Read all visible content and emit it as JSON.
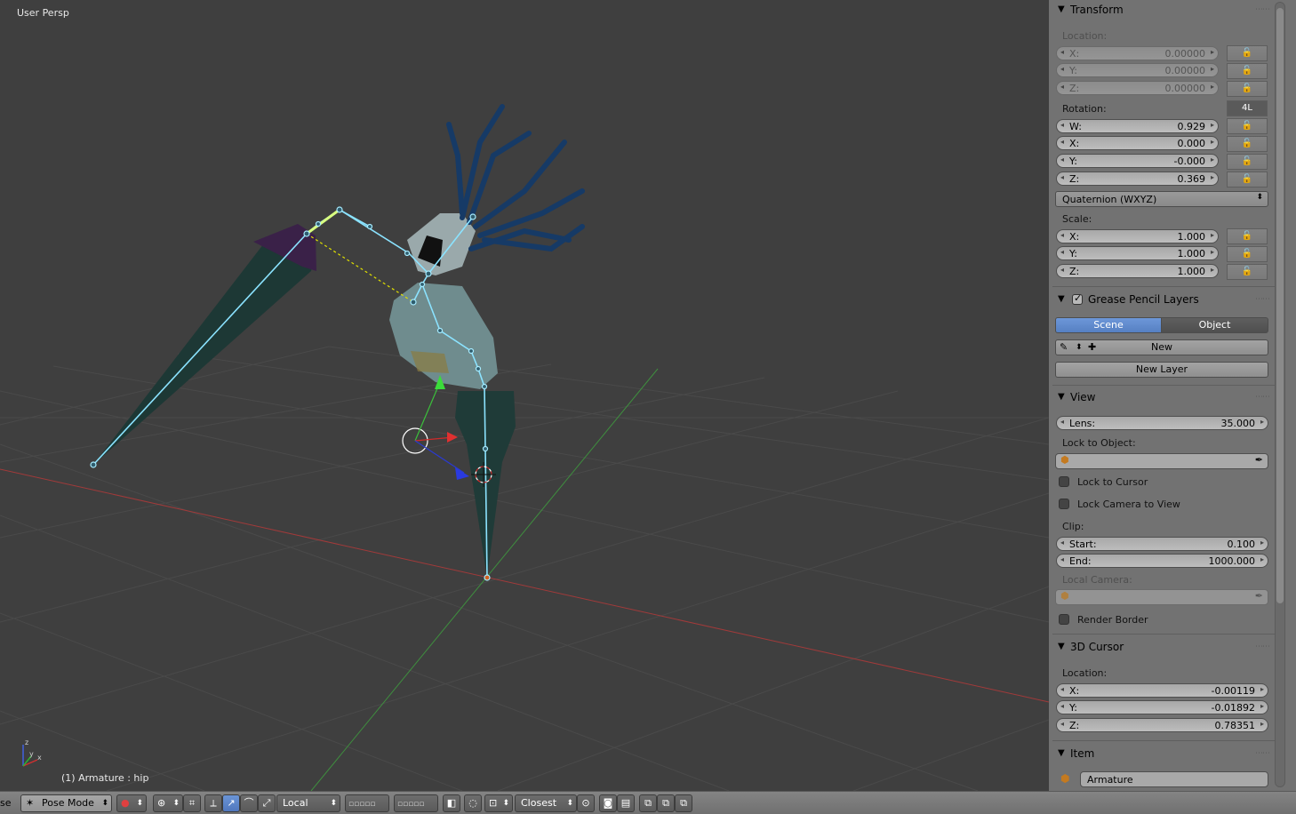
{
  "viewport": {
    "view_name": "User Persp",
    "object_label": "(1) Armature : hip"
  },
  "panels": {
    "transform": {
      "title": "Transform",
      "location_label": "Location:",
      "location": [
        {
          "axis": "X:",
          "value": "0.00000"
        },
        {
          "axis": "Y:",
          "value": "0.00000"
        },
        {
          "axis": "Z:",
          "value": "0.00000"
        }
      ],
      "rotation_label": "Rotation:",
      "rotation_lock_4l": "4L",
      "rotation": [
        {
          "axis": "W:",
          "value": "0.929"
        },
        {
          "axis": "X:",
          "value": "0.000"
        },
        {
          "axis": "Y:",
          "value": "-0.000"
        },
        {
          "axis": "Z:",
          "value": "0.369"
        }
      ],
      "rotation_mode": "Quaternion (WXYZ)",
      "scale_label": "Scale:",
      "scale": [
        {
          "axis": "X:",
          "value": "1.000"
        },
        {
          "axis": "Y:",
          "value": "1.000"
        },
        {
          "axis": "Z:",
          "value": "1.000"
        }
      ]
    },
    "grease_pencil": {
      "title": "Grease Pencil Layers",
      "tab_scene": "Scene",
      "tab_object": "Object",
      "new_label": "New",
      "new_layer_label": "New Layer"
    },
    "view": {
      "title": "View",
      "lens_label": "Lens:",
      "lens_value": "35.000",
      "lock_to_object_label": "Lock to Object:",
      "lock_to_cursor_label": "Lock to Cursor",
      "lock_camera_label": "Lock Camera to View",
      "clip_label": "Clip:",
      "clip_start_label": "Start:",
      "clip_start_value": "0.100",
      "clip_end_label": "End:",
      "clip_end_value": "1000.000",
      "local_camera_label": "Local Camera:",
      "render_border_label": "Render Border"
    },
    "cursor": {
      "title": "3D Cursor",
      "location_label": "Location:",
      "location": [
        {
          "axis": "X:",
          "value": "-0.00119"
        },
        {
          "axis": "Y:",
          "value": "-0.01892"
        },
        {
          "axis": "Z:",
          "value": "0.78351"
        }
      ]
    },
    "item": {
      "title": "Item",
      "name": "Armature"
    }
  },
  "toolbar": {
    "left_fragment": "se",
    "mode": "Pose Mode",
    "orientation": "Local",
    "snap_target": "Closest"
  },
  "colors": {
    "selection_blue": "#5680c2",
    "bone_outline": "#7fd9ff",
    "active_bone": "#d6ff7a",
    "x_axis": "#b03030",
    "y_axis": "#3a9a3a",
    "body_fill": "#1b3431"
  }
}
